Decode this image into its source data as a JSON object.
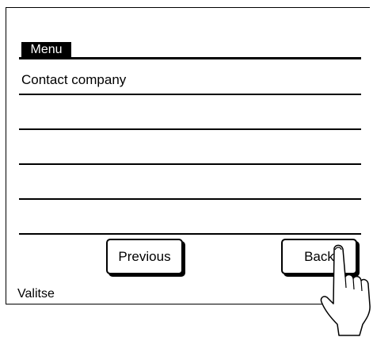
{
  "menu": {
    "title": "Menu"
  },
  "list": {
    "items": [
      "Contact company",
      "",
      "",
      "",
      ""
    ]
  },
  "buttons": {
    "previous_label": "Previous",
    "back_label": "Back"
  },
  "status": {
    "text": "Valitse"
  },
  "icons": {
    "hand": "pointing-hand-icon"
  }
}
